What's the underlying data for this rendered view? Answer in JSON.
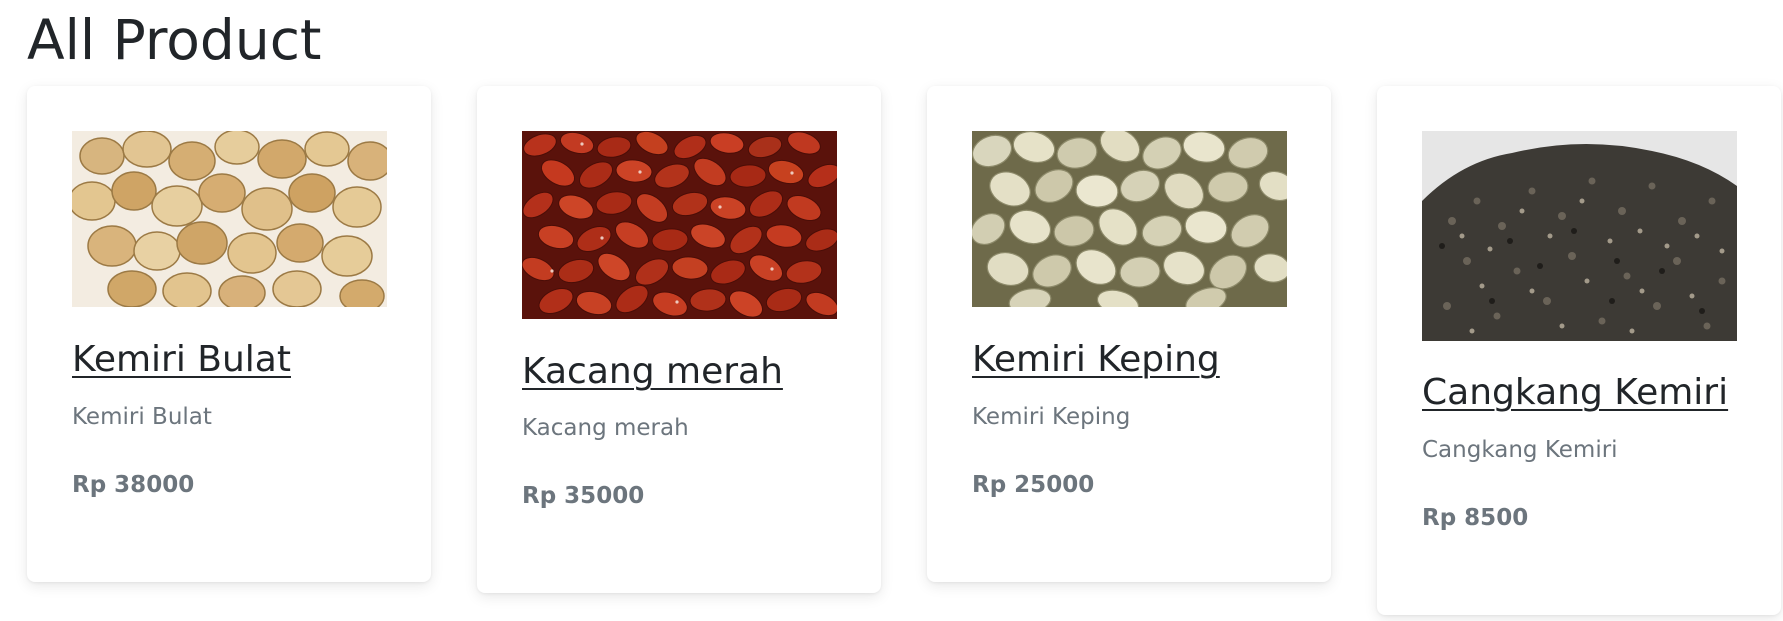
{
  "page": {
    "title": "All Product"
  },
  "products": [
    {
      "name": "Kemiri Bulat",
      "description": "Kemiri Bulat",
      "price": "Rp 38000",
      "image_icon": "kemiri-bulat-image"
    },
    {
      "name": "Kacang merah",
      "description": "Kacang merah",
      "price": "Rp 35000",
      "image_icon": "kacang-merah-image"
    },
    {
      "name": "Kemiri Keping",
      "description": "Kemiri Keping",
      "price": "Rp 25000",
      "image_icon": "kemiri-keping-image"
    },
    {
      "name": "Cangkang Kemiri",
      "description": "Cangkang Kemiri",
      "price": "Rp 8500",
      "image_icon": "cangkang-kemiri-image"
    }
  ],
  "colors": {
    "heading": "#212529",
    "muted": "#6c757d",
    "card_background": "#ffffff"
  }
}
